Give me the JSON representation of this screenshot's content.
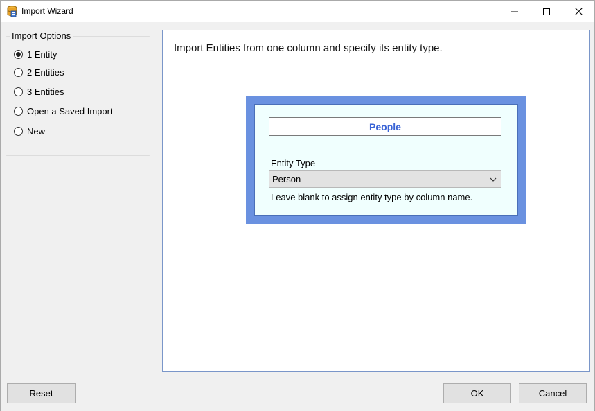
{
  "window": {
    "title": "Import Wizard",
    "icon": "database-icon"
  },
  "import_options": {
    "legend": "Import Options",
    "options": [
      {
        "label": "1 Entity",
        "selected": true
      },
      {
        "label": "2 Entities",
        "selected": false
      },
      {
        "label": "3 Entities",
        "selected": false
      },
      {
        "label": "Open a Saved Import",
        "selected": false
      },
      {
        "label": "New",
        "selected": false
      }
    ]
  },
  "main": {
    "description": "Import Entities from one column and specify its entity type.",
    "entity": {
      "name": "People",
      "type_label": "Entity Type",
      "type_value": "Person",
      "hint": "Leave blank to assign entity type by column name."
    }
  },
  "buttons": {
    "reset": "Reset",
    "ok": "OK",
    "cancel": "Cancel"
  },
  "colors": {
    "accent_card": "#6a91e0",
    "entity_name_text": "#3a64d6",
    "card_inner_bg": "#f0fffe"
  }
}
